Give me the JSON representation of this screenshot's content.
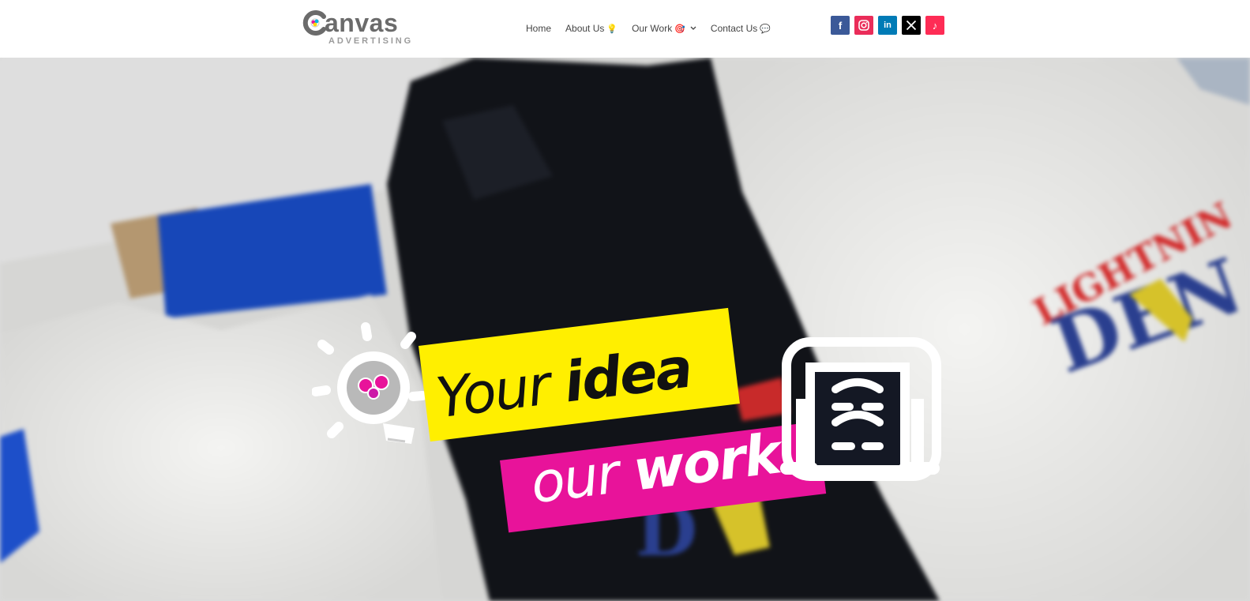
{
  "brand": {
    "logo_word": "anvas",
    "logo_sub": "ADVERTISING"
  },
  "nav": {
    "home": "Home",
    "about": "About Us",
    "about_emoji": "💡",
    "work": "Our Work",
    "work_emoji": "🎯",
    "contact": "Contact Us",
    "contact_emoji": "💬"
  },
  "social": [
    {
      "name": "facebook-icon",
      "glyph": "f",
      "color": "#3b5998"
    },
    {
      "name": "instagram-icon",
      "glyph": "◎",
      "color": "#ea2c59"
    },
    {
      "name": "linkedin-icon",
      "glyph": "in",
      "color": "#007bb6"
    },
    {
      "name": "x-icon",
      "glyph": "X",
      "color": "#000000"
    },
    {
      "name": "tiktok-icon",
      "glyph": "♪",
      "color": "#fe2c55"
    }
  ],
  "hero": {
    "line1_light": "Your ",
    "line1_bold": "idea",
    "line2_light": "our ",
    "line2_bold": "work",
    "yellow": "#ffef00",
    "pink": "#e8139a"
  }
}
